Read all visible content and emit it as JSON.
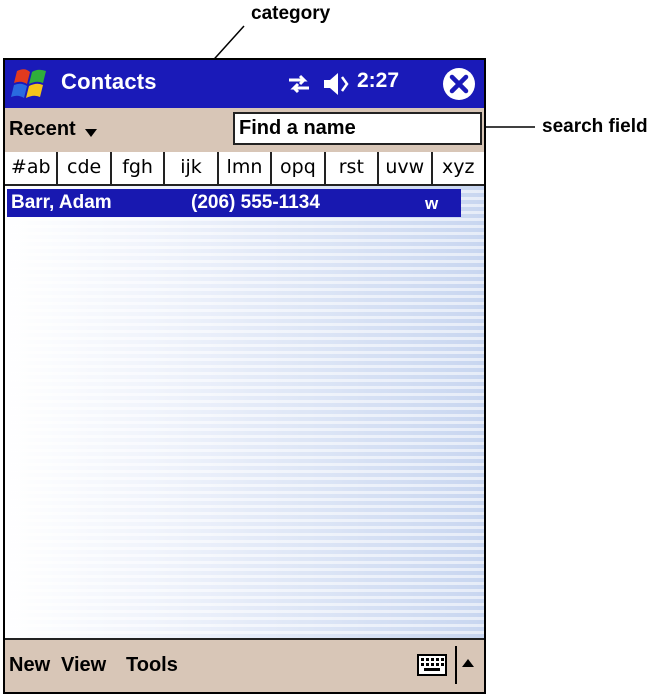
{
  "annotations": {
    "category_label": "category",
    "search_field_label": "search field"
  },
  "titlebar": {
    "title": "Contacts",
    "clock": "2:27",
    "icons": [
      "start-icon",
      "connectivity-icon",
      "speaker-icon",
      "close-icon"
    ]
  },
  "filter": {
    "category_value": "Recent",
    "search_value": "Find a name"
  },
  "tabs": [
    "#ab",
    "cde",
    "fgh",
    "ijk",
    "lmn",
    "opq",
    "rst",
    "uvw",
    "xyz"
  ],
  "contacts": [
    {
      "name": "Barr, Adam",
      "phone": "(206) 555-1134",
      "type": "w"
    }
  ],
  "menubar": {
    "items": [
      "New",
      "View",
      "Tools"
    ],
    "icons": [
      "keyboard-icon",
      "arrow-up-icon"
    ]
  },
  "colors": {
    "titlebar": "#1a1ab8",
    "toolbar": "#d8c6b7",
    "selection": "#1818b0"
  }
}
